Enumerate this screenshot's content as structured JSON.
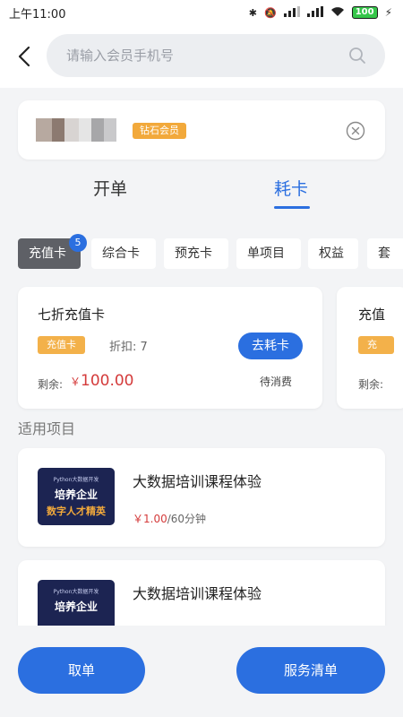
{
  "status_bar": {
    "time": "上午11:00",
    "battery": "100"
  },
  "search": {
    "placeholder": "请输入会员手机号"
  },
  "member": {
    "level_badge": "钻石会员"
  },
  "main_tabs": [
    {
      "label": "开单"
    },
    {
      "label": "耗卡"
    }
  ],
  "categories": [
    {
      "label": "充值卡",
      "badge": "5"
    },
    {
      "label": "综合卡"
    },
    {
      "label": "预充卡"
    },
    {
      "label": "单项目"
    },
    {
      "label": "权益"
    },
    {
      "label": "套"
    }
  ],
  "cards": [
    {
      "name": "七折充值卡",
      "tag": "充值卡",
      "discount": "折扣: 7",
      "action": "去耗卡",
      "remaining_label": "剩余:",
      "currency": "￥",
      "remaining": "100.00",
      "status": "待消费"
    },
    {
      "name": "充值",
      "tag": "充值",
      "remaining_label": "剩余:"
    }
  ],
  "section_title": "适用项目",
  "projects": [
    {
      "title": "大数据培训课程体验",
      "price": "￥1.00",
      "unit": "/60分钟",
      "thumb_small": "Python大数据开发",
      "thumb_mid": "培养企业",
      "thumb_big": "数字人才精英"
    },
    {
      "title": "大数据培训课程体验",
      "thumb_small": "Python大数据开发",
      "thumb_mid": "培养企业"
    }
  ],
  "bottom": {
    "cancel_label": "取单",
    "service_label": "服务清单"
  },
  "colors": {
    "accent": "#2b6fe0",
    "price": "#d43b3b",
    "vip_badge": "#f2a93b",
    "active_chip": "#5e6066"
  }
}
